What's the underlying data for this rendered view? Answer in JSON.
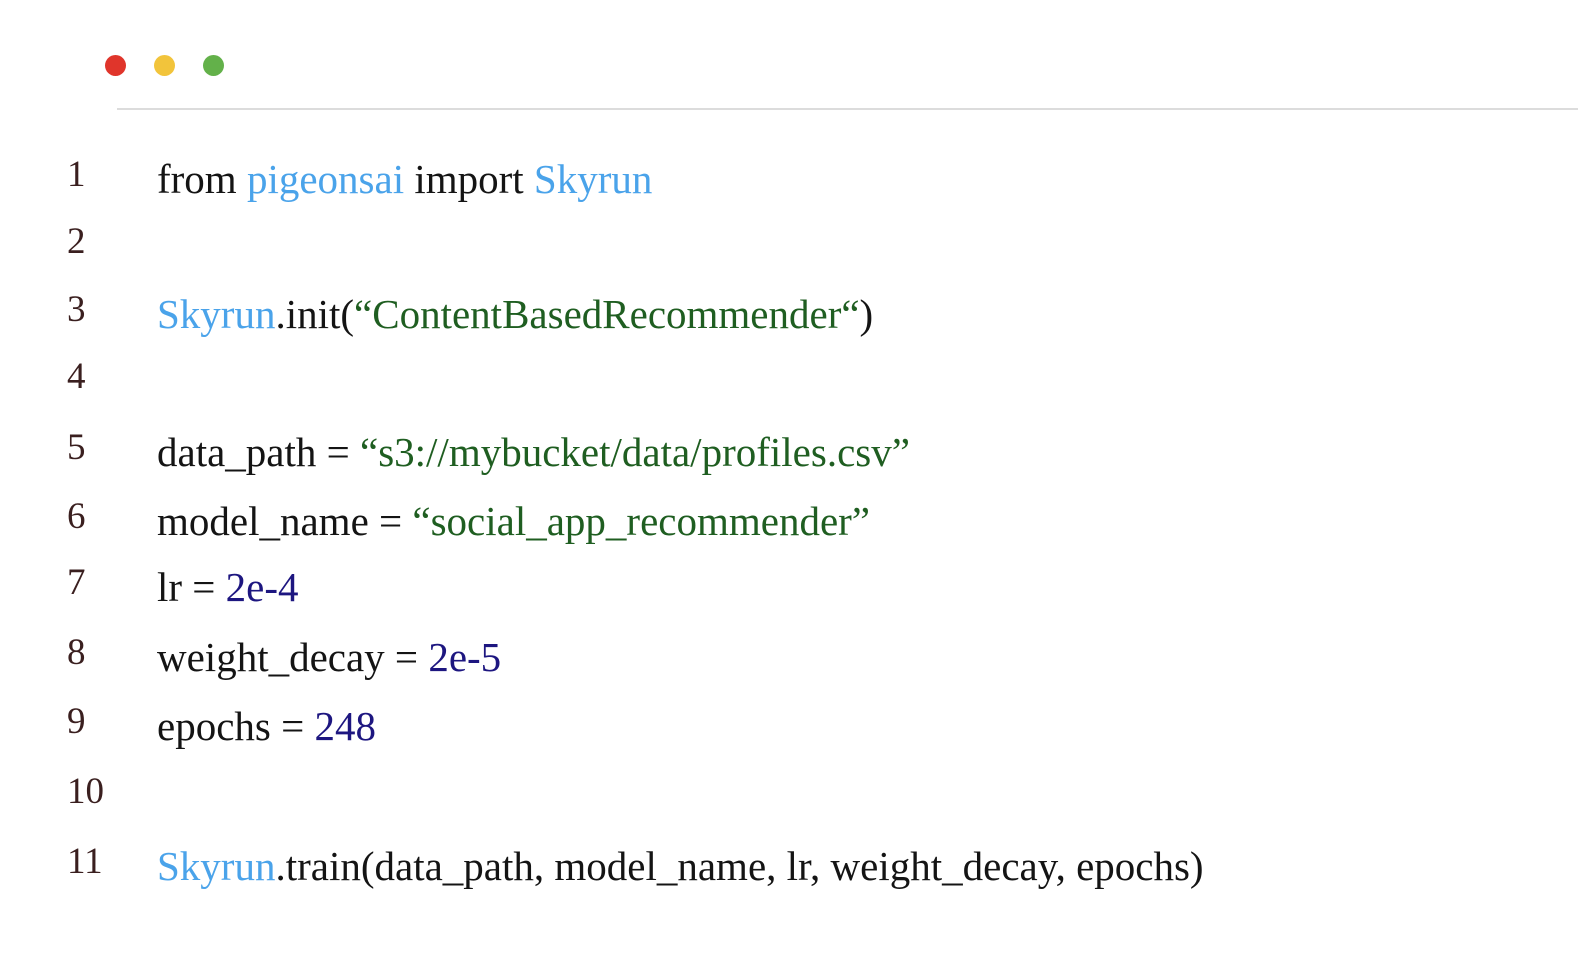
{
  "window_controls": {
    "close_color": "#e0352b",
    "minimize_color": "#f2c43b",
    "maximize_color": "#63b14a"
  },
  "colors": {
    "plain": "#141414",
    "identifier": "#4aa3ea",
    "string": "#1f5e21",
    "number": "#1d1680",
    "line_number": "#3a1f1f"
  },
  "code_lines": [
    {
      "number": "1",
      "tokens": [
        {
          "text": "from ",
          "type": "plain"
        },
        {
          "text": "pigeonsai",
          "type": "ident"
        },
        {
          "text": " import ",
          "type": "plain"
        },
        {
          "text": "Skyrun",
          "type": "ident"
        }
      ]
    },
    {
      "number": "2",
      "tokens": []
    },
    {
      "number": "3",
      "tokens": [
        {
          "text": "Skyrun",
          "type": "ident"
        },
        {
          "text": ".init(",
          "type": "plain"
        },
        {
          "text": "“ContentBasedRecommender“",
          "type": "string"
        },
        {
          "text": ")",
          "type": "plain"
        }
      ]
    },
    {
      "number": "4",
      "tokens": []
    },
    {
      "number": "5",
      "tokens": [
        {
          "text": "data_path = ",
          "type": "plain"
        },
        {
          "text": "“s3://mybucket/data/profiles.csv”",
          "type": "string"
        }
      ]
    },
    {
      "number": "6",
      "tokens": [
        {
          "text": "model_name = ",
          "type": "plain"
        },
        {
          "text": "“social_app_recommender”",
          "type": "string"
        }
      ]
    },
    {
      "number": "7",
      "tokens": [
        {
          "text": "lr = ",
          "type": "plain"
        },
        {
          "text": "2e-4",
          "type": "number"
        }
      ]
    },
    {
      "number": "8",
      "tokens": [
        {
          "text": "weight_decay = ",
          "type": "plain"
        },
        {
          "text": "2e-5",
          "type": "number"
        }
      ]
    },
    {
      "number": "9",
      "tokens": [
        {
          "text": "epochs = ",
          "type": "plain"
        },
        {
          "text": "248",
          "type": "number"
        }
      ]
    },
    {
      "number": "10",
      "tokens": []
    },
    {
      "number": "11",
      "tokens": [
        {
          "text": "Skyrun",
          "type": "ident"
        },
        {
          "text": ".train(data_path, model_name, lr, weight_decay, epochs)",
          "type": "plain"
        }
      ]
    }
  ]
}
